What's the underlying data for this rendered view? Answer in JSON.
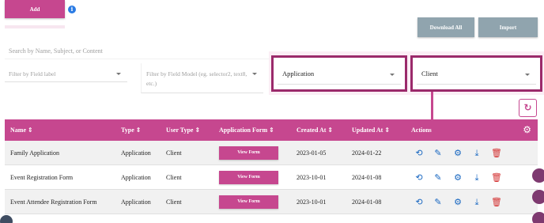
{
  "toolbar": {
    "add_label": "Add",
    "info_glyph": "i",
    "download_all_label": "Download All",
    "import_label": "Import"
  },
  "search": {
    "placeholder": "Search by Name, Subject, or Content"
  },
  "filters": {
    "field_label_placeholder": "Filter by Field label",
    "field_model_placeholder": "Filter by Field Model (eg. selector2, text8, etc.)",
    "application_value": "Application",
    "client_value": "Client"
  },
  "table": {
    "headers": {
      "name": "Name",
      "type": "Type",
      "user_type": "User Type",
      "application_form": "Application Form",
      "created_at": "Created At",
      "updated_at": "Updated At",
      "actions": "Actions"
    },
    "view_form_label": "View Form",
    "rows": [
      {
        "name": "Family Application",
        "type": "Application",
        "user_type": "Client",
        "created_at": "2023-01-05",
        "updated_at": "2024-01-22"
      },
      {
        "name": "Event Registration Form",
        "type": "Application",
        "user_type": "Client",
        "created_at": "2023-10-01",
        "updated_at": "2024-01-08"
      },
      {
        "name": "Event Attendee Registration Form",
        "type": "Application",
        "user_type": "Client",
        "created_at": "2023-10-01",
        "updated_at": "2024-01-08"
      }
    ]
  },
  "icons": {
    "sort": "⇕",
    "refresh": "↻",
    "gear": "⚙",
    "history": "⟲",
    "edit": "✎",
    "settings": "⚙",
    "download": "⤓",
    "delete": "🗑"
  },
  "colors": {
    "brand": "#c6478f",
    "highlight_border": "#9b2a6b",
    "secondary_button": "#90a4ae",
    "action_blue": "#1565c0",
    "delete_red": "#d32f2f"
  }
}
